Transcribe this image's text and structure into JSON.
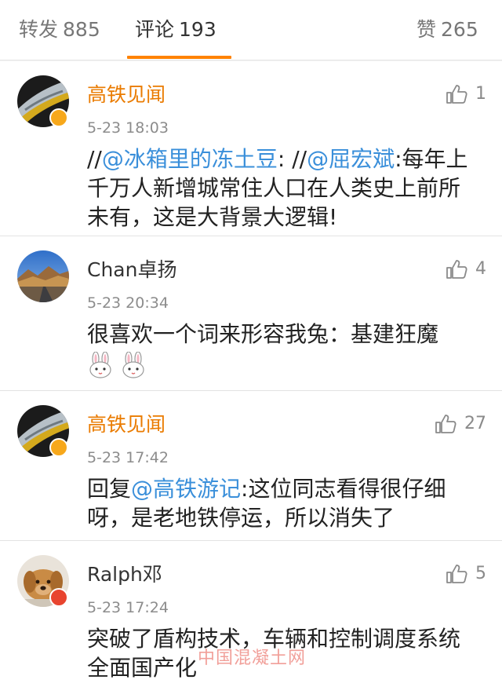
{
  "tabs": {
    "repost": {
      "label": "转发",
      "count": "885"
    },
    "comments": {
      "label": "评论",
      "count": "193"
    },
    "likes": {
      "label": "赞",
      "count": "265"
    }
  },
  "comments": [
    {
      "username": "高铁见闻",
      "time": "5-23 18:03",
      "likes": "1",
      "text_prefix": "//",
      "mention_1": "@冰箱里的冻土豆",
      "text_mid": ": //",
      "mention_2": "@屈宏斌",
      "text_suffix": ":每年上千万人新增城常住人口在人类史上前所未有，这是大背景大逻辑!"
    },
    {
      "username": "Chan卓扬",
      "time": "5-23 20:34",
      "likes": "4",
      "text": "很喜欢一个词来形容我兔：基建狂魔"
    },
    {
      "username": "高铁见闻",
      "time": "5-23 17:42",
      "likes": "27",
      "text_prefix": "回复",
      "mention": "@高铁游记",
      "text_suffix": ":这位同志看得很仔细呀，是老地铁停运，所以消失了"
    },
    {
      "username": "Ralph邓",
      "time": "5-23 17:24",
      "likes": "5",
      "text": "突破了盾构技术，车辆和控制调度系统全面国产化"
    }
  ],
  "watermark": "中国混凝土网",
  "colors": {
    "accent": "#ff8200",
    "username_highlight": "#ea7b00",
    "mention": "#3a8fda",
    "verified_gold": "#f7a81b",
    "verified_red": "#e8442f"
  },
  "icons": {
    "like": "thumbs-up-icon",
    "emoji": "rabbit-emoji-icon"
  }
}
